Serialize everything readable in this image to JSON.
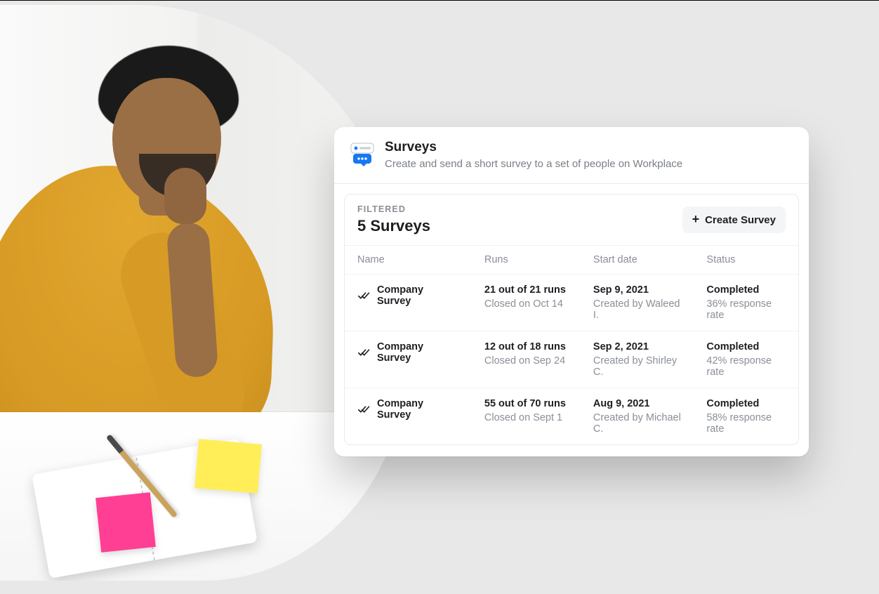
{
  "header": {
    "title": "Surveys",
    "subtitle": "Create and send a short survey to a set of people on Workplace"
  },
  "card": {
    "filtered_label": "FILTERED",
    "count_title": "5 Surveys",
    "create_button_label": "Create Survey"
  },
  "table": {
    "columns": {
      "name": "Name",
      "runs": "Runs",
      "start": "Start date",
      "status": "Status"
    },
    "rows": [
      {
        "name": "Company Survey",
        "runs_main": "21 out of 21 runs",
        "runs_sub": "Closed on Oct 14",
        "start_main": "Sep 9, 2021",
        "start_sub": "Created by Waleed I.",
        "status_main": "Completed",
        "status_sub": "36% response rate"
      },
      {
        "name": "Company Survey",
        "runs_main": "12 out of 18 runs",
        "runs_sub": "Closed on Sep 24",
        "start_main": "Sep 2, 2021",
        "start_sub": "Created by Shirley C.",
        "status_main": "Completed",
        "status_sub": "42% response rate"
      },
      {
        "name": "Company Survey",
        "runs_main": "55 out of 70 runs",
        "runs_sub": "Closed on Sept 1",
        "start_main": "Aug 9, 2021",
        "start_sub": "Created by Michael C.",
        "status_main": "Completed",
        "status_sub": "58% response rate"
      }
    ]
  },
  "colors": {
    "accent_blue": "#1877F2",
    "text_primary": "#1c1e21",
    "text_secondary": "#8a8f97"
  }
}
